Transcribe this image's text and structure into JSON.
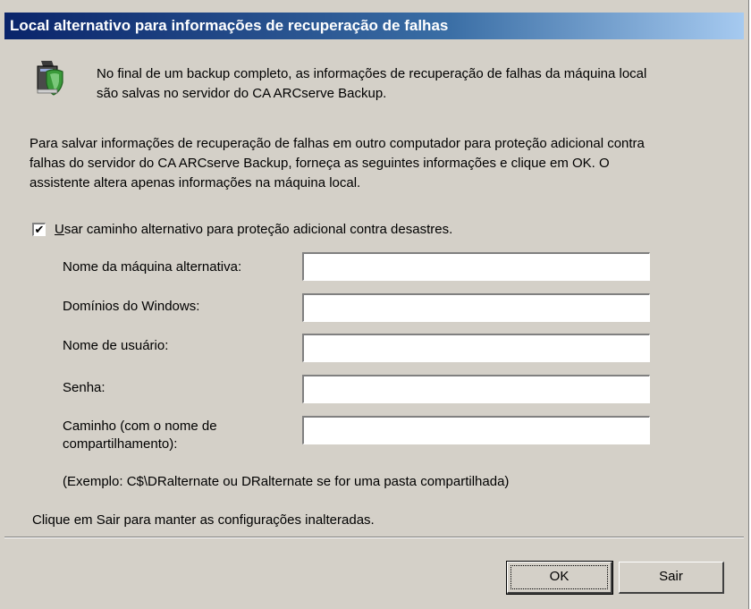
{
  "window": {
    "title": "Local alternativo para informações de recuperação de falhas"
  },
  "icons": {
    "header_icon": "backup-shield-icon"
  },
  "intro": {
    "line1": "No final de um backup completo, as informações de recuperação de falhas da máquina local",
    "line2": "são salvas no servidor do CA ARCserve Backup."
  },
  "description": {
    "line1": "Para salvar informações de recuperação de falhas em outro computador para proteção adicional contra",
    "line2": "falhas do servidor do CA ARCserve Backup, forneça as seguintes informações e clique em OK. O",
    "line3": "assistente altera apenas informações na máquina local."
  },
  "alt_path_checkbox": {
    "checked": true,
    "mark": "✔",
    "label_accel": "U",
    "label_rest": "sar caminho alternativo para proteção adicional contra desastres."
  },
  "fields": {
    "machine_name": {
      "label": "Nome da máquina alternativa:",
      "value": ""
    },
    "windows_domain": {
      "label": "Domínios do Windows:",
      "value": ""
    },
    "username": {
      "label": "Nome de usuário:",
      "value": ""
    },
    "password": {
      "label": "Senha:",
      "value": ""
    },
    "path": {
      "label_line1": "Caminho (com o nome de",
      "label_line2": "compartilhamento):",
      "value": ""
    }
  },
  "example_text": "(Exemplo: C$\\DRalternate ou DRalternate se for uma pasta compartilhada)",
  "footer_text": "Clique em Sair para manter as configurações inalteradas.",
  "buttons": {
    "ok": "OK",
    "exit": "Sair"
  },
  "colors": {
    "dialog_bg": "#d4d0c8",
    "title_gradient_start": "#0a246a",
    "title_gradient_end": "#a6caf0"
  }
}
